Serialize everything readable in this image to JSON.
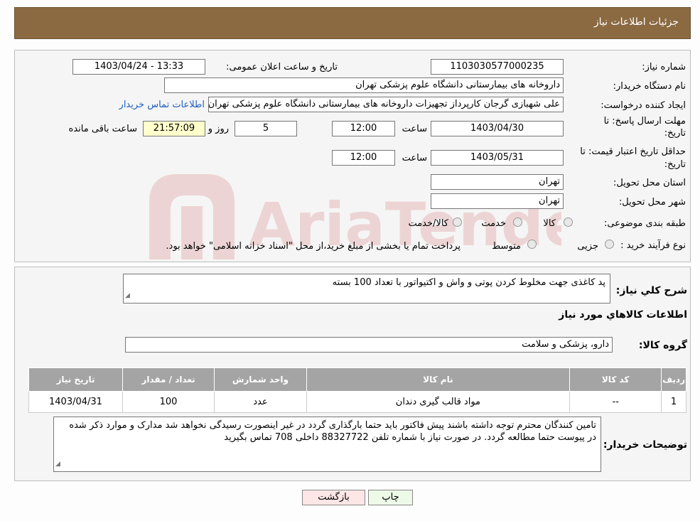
{
  "header": {
    "title": "جزئیات اطلاعات نیاز"
  },
  "form": {
    "need_number_label": "شماره نیاز:",
    "need_number": "1103030577000235",
    "announce_label": "تاریخ و ساعت اعلان عمومی:",
    "announce_value": "1403/04/24 - 13:33",
    "buyer_org_label": "نام دستگاه خریدار:",
    "buyer_org": "داروخانه های بیمارستانی دانشگاه علوم پزشکی تهران",
    "requester_label": "ایجاد کننده درخواست:",
    "requester": "علی شهبازی گرجان کارپرداز تجهیزات داروخانه های بیمارستانی دانشگاه علوم پزشکی تهران",
    "contact_link": "اطلاعات تماس خریدار",
    "deadline_label_1": "مهلت ارسال پاسخ: تا",
    "deadline_label_2": "تاریخ:",
    "deadline_date": "1403/04/30",
    "time_label": "ساعت",
    "deadline_time": "12:00",
    "days_value": "5",
    "days_label": "روز و",
    "remaining_time": "21:57:09",
    "remaining_label": "ساعت باقی مانده",
    "validity_label_1": "حداقل تاریخ اعتبار قیمت: تا",
    "validity_label_2": "تاریخ:",
    "validity_date": "1403/05/31",
    "validity_time_label": "ساعت",
    "validity_time": "12:00",
    "province_label": "استان محل تحویل:",
    "province": "تهران",
    "city_label": "شهر محل تحویل:",
    "city": "تهران",
    "category_label": "طبقه بندی موضوعی:",
    "category_options": [
      "کالا",
      "خدمت",
      "کالا/خدمت"
    ],
    "process_label": "نوع فرآیند خرید :",
    "process_options": [
      "جزیی",
      "متوسط"
    ],
    "payment_note": "پرداخت تمام یا بخشی از مبلغ خرید،از محل \"اسناد خزانه اسلامی\" خواهد بود."
  },
  "details": {
    "summary_label": "شرح کلي نياز:",
    "summary": "پد کاغذی جهت مخلوط کردن پوتی و واش و اکتیواتور با تعداد 100 بسته",
    "goods_info_title": "اطلاعات کالاهاي مورد نياز",
    "group_label": "گروه کالا:",
    "group_value": "دارو، پزشکی و سلامت",
    "table": {
      "headers": [
        "ردیف",
        "کد کالا",
        "نام کالا",
        "واحد شمارش",
        "تعداد / مقدار",
        "تاریخ نیاز"
      ],
      "rows": [
        [
          "1",
          "--",
          "مواد قالب گیری دندان",
          "عدد",
          "100",
          "1403/04/31"
        ]
      ]
    },
    "buyer_notes_label": "توضیحات خریدار:",
    "buyer_notes": "تامین کنندگان محترم توجه داشته باشند پیش فاکتور باید حتما بارگذاری گردد در غیر اینصورت رسیدگی نخواهد شد مدارک و موارد ذکر شده در پیوست حتما مطالعه گردد. در صورت نیاز با شماره تلفن 88327722 داخلی 708 تماس بگیرید"
  },
  "buttons": {
    "print": "چاپ",
    "back": "بازگشت"
  },
  "watermark": "AriaTender.neT"
}
